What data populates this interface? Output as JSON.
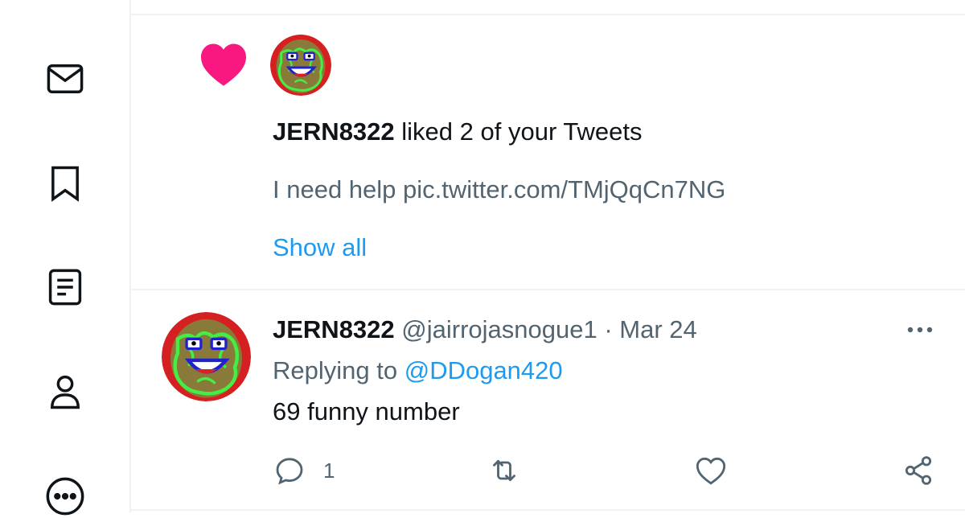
{
  "sidebar": {
    "items": [
      {
        "name": "messages",
        "icon": "envelope-icon"
      },
      {
        "name": "bookmarks",
        "icon": "bookmark-icon"
      },
      {
        "name": "lists",
        "icon": "list-document-icon"
      },
      {
        "name": "profile",
        "icon": "person-icon"
      },
      {
        "name": "more",
        "icon": "more-circle-icon"
      }
    ]
  },
  "notification": {
    "icon": "heart-icon",
    "icon_color": "#f91880",
    "user": "JERN8322",
    "action_text": " liked 2 of your Tweets",
    "tweet_preview": "I need help pic.twitter.com/TMjQqCn7NG",
    "show_all": "Show all"
  },
  "tweet": {
    "display_name": "JERN8322",
    "handle": " @jairrojasnogue1",
    "separator": " · ",
    "date": "Mar 24",
    "replying_prefix": "Replying to ",
    "replying_to": "@DDogan420",
    "text": "69 funny number",
    "reply_count": "1",
    "actions": [
      "reply-icon",
      "retweet-icon",
      "like-icon",
      "share-icon"
    ]
  },
  "colors": {
    "accent": "#1d9bf0",
    "secondary_text": "#536471",
    "like": "#f91880"
  }
}
